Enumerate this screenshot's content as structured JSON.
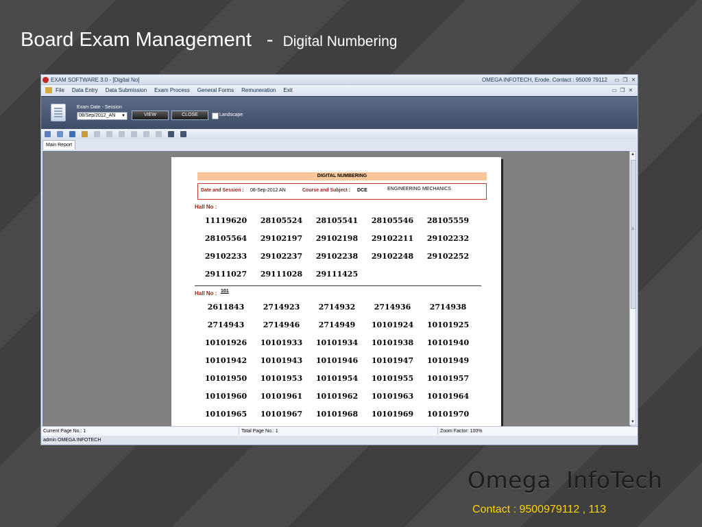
{
  "slide": {
    "title_main": "Board Exam Management",
    "title_sep": "-",
    "title_sub": "Digital Numbering",
    "brand": "Omega  InfoTech",
    "contact": "Contact : 9500979112 , 113"
  },
  "window": {
    "title": "EXAM SOFTWARE 3.0 - [Digital No]",
    "contact": "OMEGA INFOTECH, Erode. Contact : 95009 79112"
  },
  "menu": [
    "File",
    "Data Entry",
    "Data Submission",
    "Exam Process",
    "General Forms",
    "Remuneration",
    "Exit"
  ],
  "controls": {
    "session_label": "Exam Date - Session",
    "session_value": "08/Sep/2012_AN",
    "view_button": "VIEW",
    "close_button": "CLOSE",
    "landscape_label": "Landscape"
  },
  "tab": "Main Report",
  "report": {
    "heading": "DIGITAL NUMBERING",
    "date_session_label": "Date and Session :",
    "date_session_value": "08-Sep-2012  AN",
    "course_subject_label": "Course and Subject :",
    "course_code": "DCE",
    "subject_name": "ENGINEERING MECHANICS",
    "halls": [
      {
        "label": "Hall No :",
        "number": "",
        "numbers": [
          "11119620",
          "28105524",
          "28105541",
          "28105546",
          "28105559",
          "28105564",
          "29102197",
          "29102198",
          "29102211",
          "29102232",
          "29102233",
          "29102237",
          "29102238",
          "29102248",
          "29102252",
          "29111027",
          "29111028",
          "29111425"
        ]
      },
      {
        "label": "Hall No :",
        "number": "101",
        "numbers": [
          "2611843",
          "2714923",
          "2714932",
          "2714936",
          "2714938",
          "2714943",
          "2714946",
          "2714949",
          "10101924",
          "10101925",
          "10101926",
          "10101933",
          "10101934",
          "10101938",
          "10101940",
          "10101942",
          "10101943",
          "10101946",
          "10101947",
          "10101949",
          "10101950",
          "10101953",
          "10101954",
          "10101955",
          "10101957",
          "10101960",
          "10101961",
          "10101962",
          "10101963",
          "10101964",
          "10101965",
          "10101967",
          "10101968",
          "10101969",
          "10101970"
        ]
      }
    ]
  },
  "status": {
    "current_page": "Current Page No.: 1",
    "total_page": "Total Page No.: 1",
    "zoom": "Zoom Factor: 100%"
  },
  "user": "admin  OMEGA INFOTECH"
}
